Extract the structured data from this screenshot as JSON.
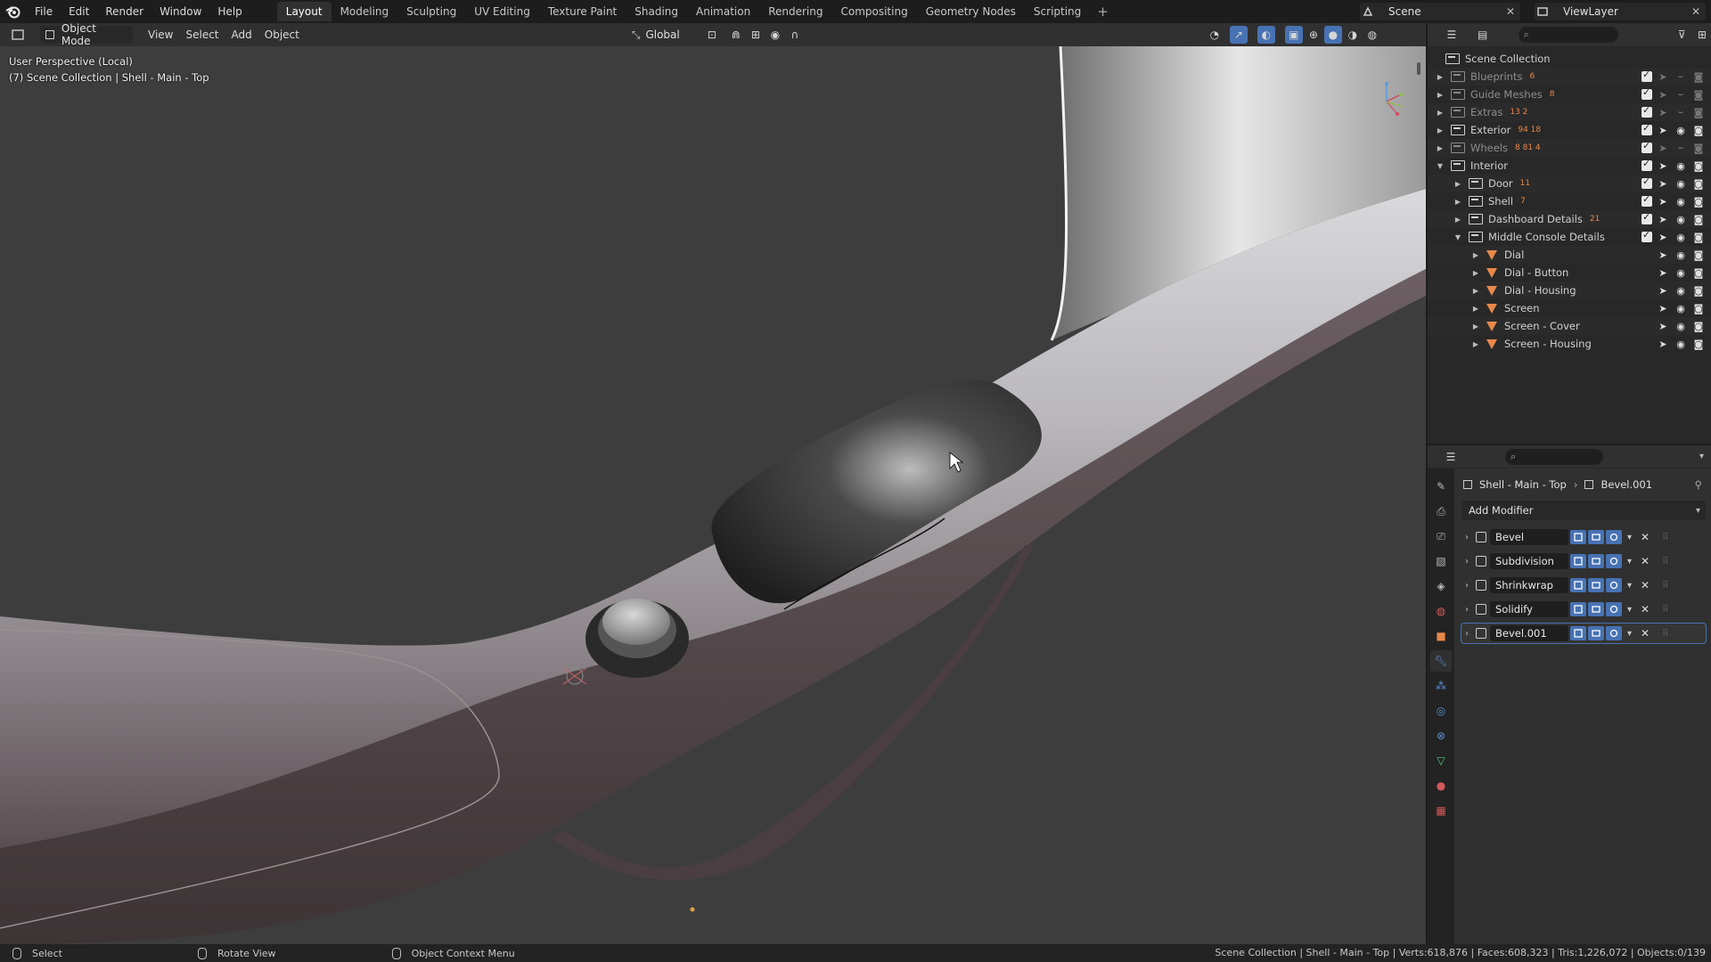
{
  "menu": [
    "File",
    "Edit",
    "Render",
    "Window",
    "Help"
  ],
  "workspaces": [
    "Layout",
    "Modeling",
    "Sculpting",
    "UV Editing",
    "Texture Paint",
    "Shading",
    "Animation",
    "Rendering",
    "Compositing",
    "Geometry Nodes",
    "Scripting"
  ],
  "active_workspace": "Layout",
  "scene": "Scene",
  "view_layer": "ViewLayer",
  "viewport": {
    "mode": "Object Mode",
    "menus": [
      "View",
      "Select",
      "Add",
      "Object"
    ],
    "orientation": "Global",
    "overlay_text_1": "User Perspective (Local)",
    "overlay_text_2": "(7) Scene Collection | Shell - Main - Top"
  },
  "outliner": {
    "root": "Scene Collection",
    "rows": [
      {
        "label": "Blueprints",
        "level": 1,
        "dim": true,
        "extras": "6"
      },
      {
        "label": "Guide Meshes",
        "level": 1,
        "dim": true,
        "extras": "8"
      },
      {
        "label": "Extras",
        "level": 1,
        "dim": true,
        "extras": "13  2"
      },
      {
        "label": "Exterior",
        "level": 1,
        "dim": false,
        "extras": "94 18"
      },
      {
        "label": "Wheels",
        "level": 1,
        "dim": true,
        "extras": "8  81  4"
      },
      {
        "label": "Interior",
        "level": 1,
        "dim": false,
        "extras": ""
      },
      {
        "label": "Door",
        "level": 2,
        "dim": false,
        "extras": "11"
      },
      {
        "label": "Shell",
        "level": 2,
        "dim": false,
        "extras": "7"
      },
      {
        "label": "Dashboard Details",
        "level": 2,
        "dim": false,
        "extras": "21"
      },
      {
        "label": "Middle Console Details",
        "level": 2,
        "dim": false,
        "extras": ""
      },
      {
        "label": "Dial",
        "level": 3,
        "dim": false,
        "extras": ""
      },
      {
        "label": "Dial - Button",
        "level": 3,
        "dim": false,
        "extras": ""
      },
      {
        "label": "Dial - Housing",
        "level": 3,
        "dim": false,
        "extras": ""
      },
      {
        "label": "Screen",
        "level": 3,
        "dim": false,
        "extras": ""
      },
      {
        "label": "Screen - Cover",
        "level": 3,
        "dim": false,
        "extras": ""
      },
      {
        "label": "Screen - Housing",
        "level": 3,
        "dim": false,
        "extras": ""
      }
    ]
  },
  "properties": {
    "object": "Shell - Main - Top",
    "modifier_ctx": "Bevel.001",
    "add_modifier": "Add Modifier",
    "modifiers": [
      "Bevel",
      "Subdivision",
      "Shrinkwrap",
      "Solidify",
      "Bevel.001"
    ],
    "active_modifier": "Bevel.001"
  },
  "status": {
    "select": "Select",
    "rotate": "Rotate View",
    "context": "Object Context Menu",
    "stats": "Scene Collection | Shell - Main - Top | Verts:618,876 | Faces:608,323 | Tris:1,226,072 | Objects:0/139"
  },
  "colors": {
    "accent": "#4772b3",
    "mesh": "#e8884a",
    "bg": "#3d3d3d"
  }
}
